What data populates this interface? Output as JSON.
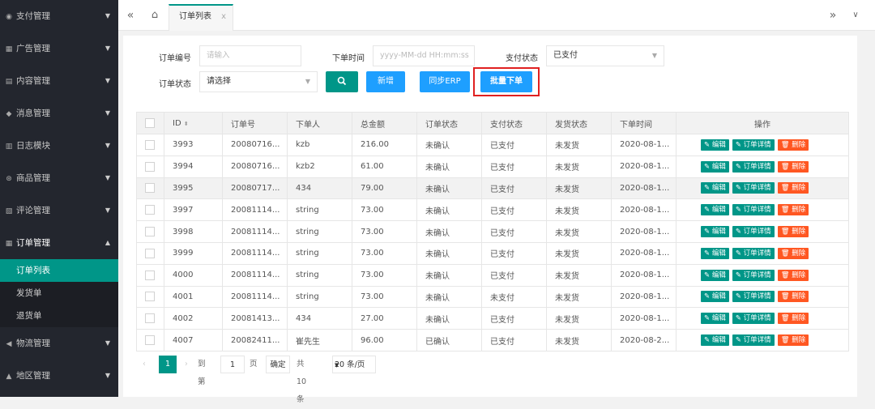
{
  "sidebar": {
    "items": [
      {
        "icon": "circle-dollar-icon",
        "glyph": "◉",
        "label": "支付管理"
      },
      {
        "icon": "grid-icon",
        "glyph": "▦",
        "label": "广告管理"
      },
      {
        "icon": "content-icon",
        "glyph": "▤",
        "label": "内容管理"
      },
      {
        "icon": "message-icon",
        "glyph": "◆",
        "label": "消息管理"
      },
      {
        "icon": "log-icon",
        "glyph": "▥",
        "label": "日志模块"
      },
      {
        "icon": "goods-icon",
        "glyph": "⊛",
        "label": "商品管理"
      },
      {
        "icon": "comment-icon",
        "glyph": "▧",
        "label": "评论管理"
      },
      {
        "icon": "order-icon",
        "glyph": "▦",
        "label": "订单管理"
      }
    ],
    "sub_items": [
      {
        "label": "订单列表"
      },
      {
        "label": "发货单"
      },
      {
        "label": "退货单"
      }
    ],
    "bottom_items": [
      {
        "icon": "send-icon",
        "glyph": "◀",
        "label": "物流管理"
      },
      {
        "icon": "location-icon",
        "glyph": "▲",
        "label": "地区管理"
      }
    ]
  },
  "topbar": {
    "tab_label": "订单列表",
    "tab_close": "x"
  },
  "filters": {
    "order_no_label": "订单编号",
    "order_no_placeholder": "请输入",
    "order_time_label": "下单时间",
    "order_time_placeholder": "yyyy-MM-dd HH:mm:ss",
    "pay_status_label": "支付状态",
    "pay_status_value": "已支付",
    "order_status_label": "订单状态",
    "order_status_value": "请选择"
  },
  "buttons": {
    "add": "新增",
    "sync": "同步ERP",
    "batch": "批量下单"
  },
  "table": {
    "headers": [
      "ID",
      "订单号",
      "下单人",
      "总金额",
      "订单状态",
      "支付状态",
      "发货状态",
      "下单时间",
      "操作"
    ],
    "op_edit": "编辑",
    "op_detail": "订单详情",
    "op_delete": "删除",
    "rows": [
      {
        "id": "3993",
        "no": "20080716...",
        "user": "kzb",
        "amount": "216.00",
        "status": "未确认",
        "pay": "已支付",
        "ship": "未发货",
        "time": "2020-08-1..."
      },
      {
        "id": "3994",
        "no": "20080716...",
        "user": "kzb2",
        "amount": "61.00",
        "status": "未确认",
        "pay": "已支付",
        "ship": "未发货",
        "time": "2020-08-1..."
      },
      {
        "id": "3995",
        "no": "20080717...",
        "user": "434",
        "amount": "79.00",
        "status": "未确认",
        "pay": "已支付",
        "ship": "未发货",
        "time": "2020-08-1..."
      },
      {
        "id": "3997",
        "no": "20081114...",
        "user": "string",
        "amount": "73.00",
        "status": "未确认",
        "pay": "已支付",
        "ship": "未发货",
        "time": "2020-08-1..."
      },
      {
        "id": "3998",
        "no": "20081114...",
        "user": "string",
        "amount": "73.00",
        "status": "未确认",
        "pay": "已支付",
        "ship": "未发货",
        "time": "2020-08-1..."
      },
      {
        "id": "3999",
        "no": "20081114...",
        "user": "string",
        "amount": "73.00",
        "status": "未确认",
        "pay": "已支付",
        "ship": "未发货",
        "time": "2020-08-1..."
      },
      {
        "id": "4000",
        "no": "20081114...",
        "user": "string",
        "amount": "73.00",
        "status": "未确认",
        "pay": "已支付",
        "ship": "未发货",
        "time": "2020-08-1..."
      },
      {
        "id": "4001",
        "no": "20081114...",
        "user": "string",
        "amount": "73.00",
        "status": "未确认",
        "pay": "未支付",
        "ship": "未发货",
        "time": "2020-08-1..."
      },
      {
        "id": "4002",
        "no": "20081413...",
        "user": "434",
        "amount": "27.00",
        "status": "未确认",
        "pay": "已支付",
        "ship": "未发货",
        "time": "2020-08-1..."
      },
      {
        "id": "4007",
        "no": "20082411...",
        "user": "崔先生",
        "amount": "96.00",
        "status": "已确认",
        "pay": "已支付",
        "ship": "未发货",
        "time": "2020-08-2..."
      }
    ]
  },
  "pager": {
    "current": "1",
    "goto_label": "到第",
    "goto_value": "1",
    "page_unit": "页",
    "confirm": "确定",
    "total": "共 10 条",
    "per_page": "20 条/页"
  },
  "colors": {
    "primary": "#009688",
    "info": "#1e9fff",
    "danger": "#ff5722",
    "sidebar": "#23262e",
    "highlight_border": "#e02020"
  }
}
